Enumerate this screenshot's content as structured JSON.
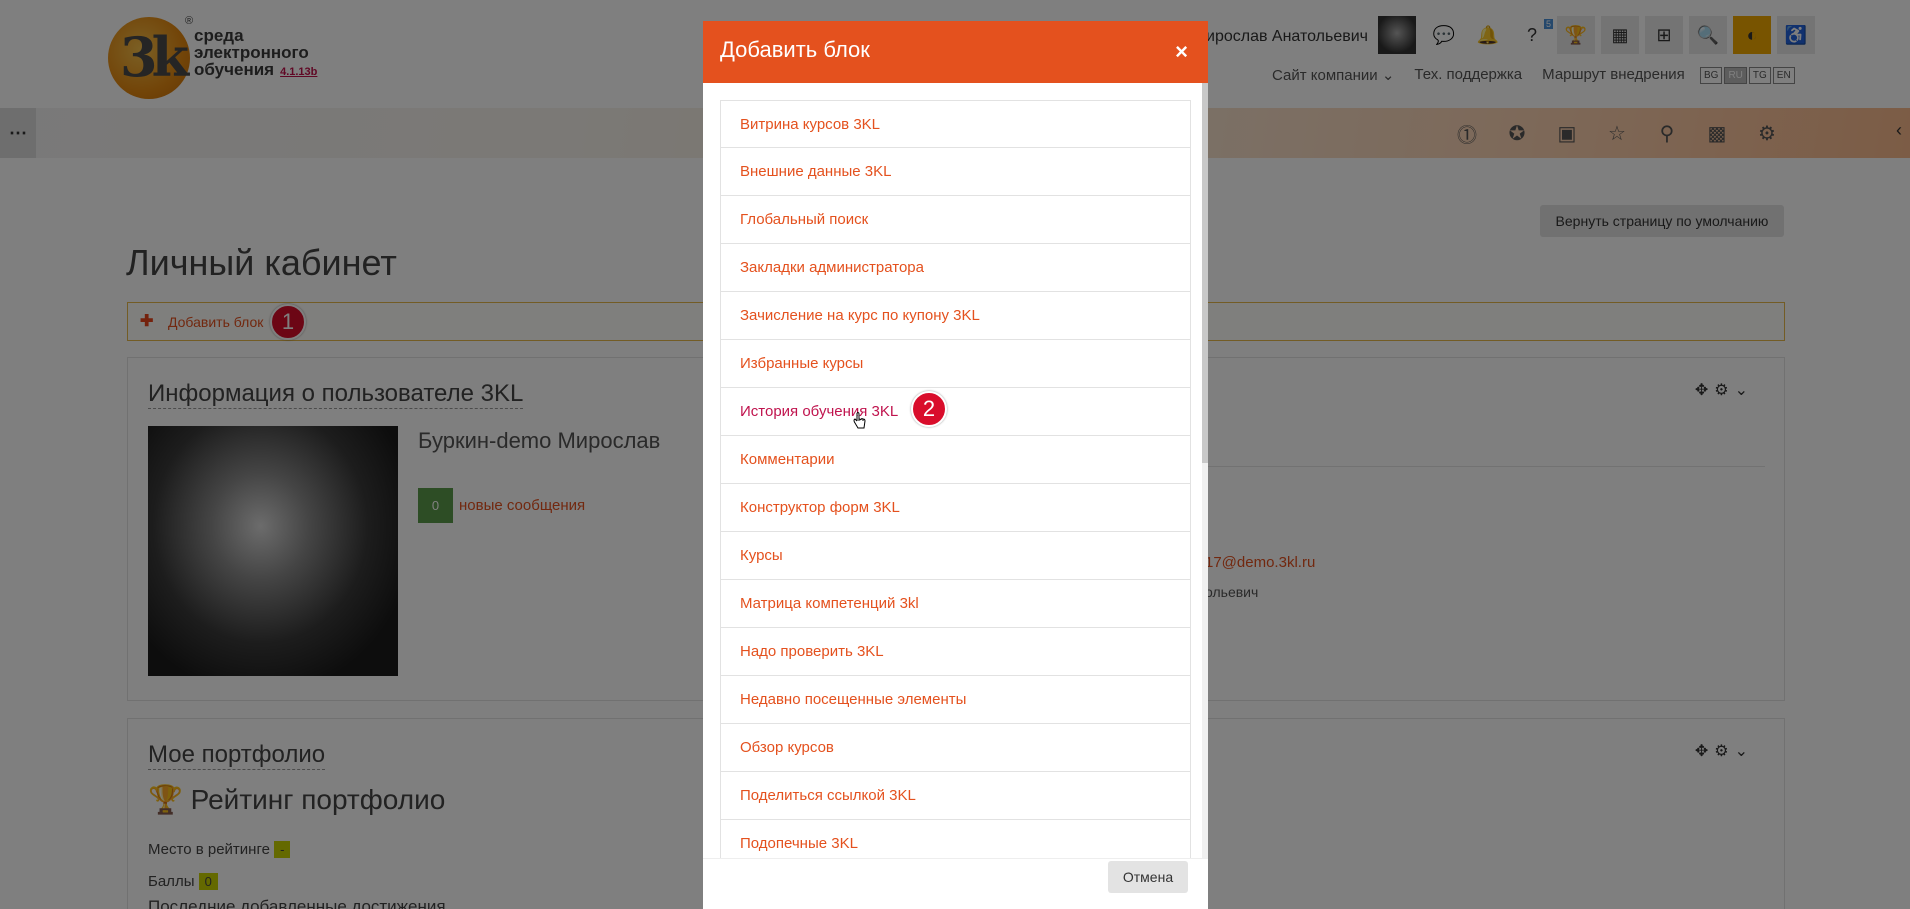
{
  "header": {
    "logo_text_line1": "среда",
    "logo_text_line2": "электронного",
    "logo_text_line3": "обучения",
    "logo_version": "4.1.13b",
    "logo_mark": "3k",
    "logo_reg": "®",
    "user_name": "ирослав Анатольевич",
    "links": [
      "Сайт компании ⌄",
      "Тех. поддержка",
      "Маршрут внедрения"
    ],
    "languages": [
      "BG",
      "RU",
      "TG",
      "EN"
    ],
    "active_language": "RU",
    "help_count": "5"
  },
  "page": {
    "title": "Личный кабинет",
    "reset_button": "Вернуть страницу по умолчанию",
    "add_block_label": "Добавить блок",
    "marker1": "1",
    "marker2": "2"
  },
  "card_user": {
    "title": "Информация о пользователе 3KL",
    "full_name": "Буркин-demo Мирослав",
    "messages_count": "0",
    "messages_label": "новые сообщения",
    "email_partial": "17@demo.3kl.ru",
    "patronymic_partial": "ольевич"
  },
  "card_portfolio": {
    "title": "Мое портфолио",
    "rating_title": "Рейтинг портфолио",
    "place_label": "Место в рейтинге",
    "place_value": "-",
    "points_label": "Баллы",
    "points_value": "0",
    "recent_label": "Последние добавленные достижения"
  },
  "modal": {
    "title": "Добавить блок",
    "close": "×",
    "cancel": "Отмена",
    "items": [
      "Витрина курсов 3KL",
      "Внешние данные 3KL",
      "Глобальный поиск",
      "Закладки администратора",
      "Зачисление на курс по купону 3KL",
      "Избранные курсы",
      "История обучения 3KL",
      "Комментарии",
      "Конструктор форм 3KL",
      "Курсы",
      "Матрица компетенций 3kl",
      "Надо проверить 3KL",
      "Недавно посещенные элементы",
      "Обзор курсов",
      "Поделиться ссылкой 3KL",
      "Подопечные 3KL"
    ]
  },
  "colors": {
    "accent": "#e4511e",
    "marker": "#d90d2b"
  }
}
